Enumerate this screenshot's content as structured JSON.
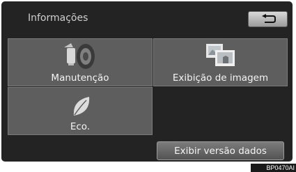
{
  "header": {
    "title": "Informações",
    "back_icon": "return-arrow-icon"
  },
  "menu": {
    "items": [
      {
        "label": "Manutenção",
        "icon": "maintenance-icon"
      },
      {
        "label": "Exibição de imagem",
        "icon": "image-display-icon"
      },
      {
        "label": "Eco.",
        "icon": "eco-leaf-icon"
      }
    ]
  },
  "footer": {
    "version_button": "Exibir versão dados"
  },
  "reference_code": "BP0470AI",
  "colors": {
    "screen_bg": "#232323",
    "tile_bg": "#5e5e5e",
    "text": "#f4f4f4"
  }
}
